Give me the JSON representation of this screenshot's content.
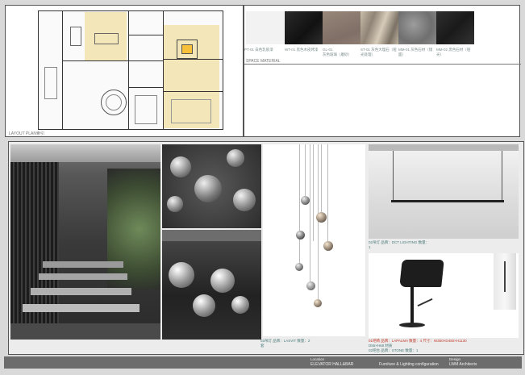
{
  "layout": {
    "label": "LAYOUT  PLAN索引"
  },
  "materials": {
    "space_label": "SPACE MATERIAL",
    "items": [
      {
        "code": "PT-01",
        "text": "白色乳胶漆",
        "color": "#f2f2f2"
      },
      {
        "code": "WT-01",
        "text": "黑色木皮烤漆",
        "color": "#1e1e1e"
      },
      {
        "code": "GL-01",
        "text": "灰色玻璃（磨砂）",
        "color": "#8a7b74"
      },
      {
        "code": "ST-01",
        "text": "灰色大理石（哑光处理）",
        "color": "#b8ab9a"
      },
      {
        "code": "MM-01",
        "text": "灰色石材（镜面）",
        "color": "#8a8a8a"
      },
      {
        "code": "MM-02",
        "text": "黑色石材（哑光）",
        "color": "#262626"
      }
    ]
  },
  "captions": {
    "pendant": "03吊灯  品牌：LASVIT  数量：2",
    "pendant_extra": "套",
    "linear": "02吊灯  品牌：DCT LIGHTING  数量：",
    "linear_extra": "1",
    "barstool_line1": "01吧椅  品牌：LAPALMA  数量：4  尺寸：W350×D450×H1130",
    "barstool_line2": "D55×H68 材质",
    "barstool_line3": "02吧台  品牌：STONE  数量：1"
  },
  "footer": {
    "location_label": "Location",
    "location_value": "ELEVATOR HALL&BAR",
    "subject": "Furniture & Lighting configuration",
    "design_label": "Design",
    "design_value": "LWM  Architects"
  }
}
